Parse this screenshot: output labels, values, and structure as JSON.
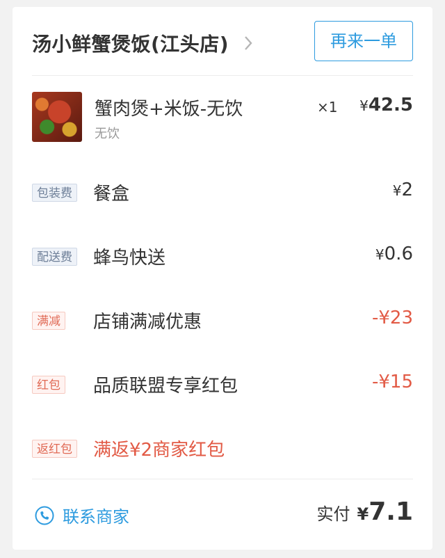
{
  "header": {
    "shop_name": "汤小鲜蟹煲饭(江头店)",
    "reorder_label": "再来一单"
  },
  "item": {
    "name": "蟹肉煲+米饭-无饮",
    "spec": "无饮",
    "quantity": "×1",
    "price_currency": "¥",
    "price_value": "42.5"
  },
  "fees": [
    {
      "tag": "包装费",
      "label": "餐盒",
      "currency": "¥",
      "amount": "2"
    },
    {
      "tag": "配送费",
      "label": "蜂鸟快送",
      "currency": "¥",
      "amount": "0.6"
    }
  ],
  "discounts": [
    {
      "tag": "满减",
      "label": "店铺满减优惠",
      "amount": "-¥23"
    },
    {
      "tag": "红包",
      "label": "品质联盟专享红包",
      "amount": "-¥15"
    }
  ],
  "bonus": {
    "tag": "返红包",
    "label": "满返¥2商家红包"
  },
  "footer": {
    "contact_label": "联系商家",
    "paid_label": "实付",
    "paid_currency": "¥",
    "paid_value": "7.1"
  },
  "colors": {
    "accent": "#2d9bdf",
    "discount": "#e25a45"
  },
  "icons": {
    "chevron": "chevron-right-icon",
    "phone": "phone-icon"
  }
}
